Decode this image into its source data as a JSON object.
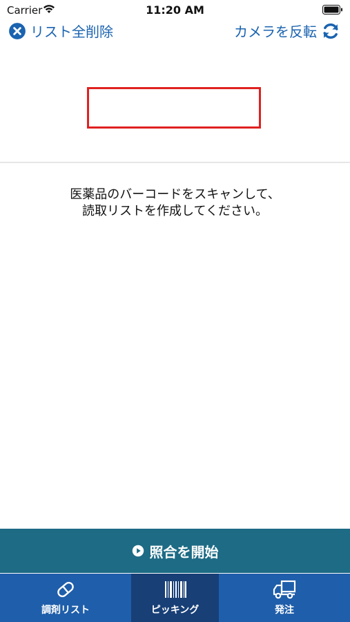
{
  "status_bar": {
    "carrier": "Carrier",
    "time": "11:20 AM"
  },
  "nav": {
    "clear_list_label": "リスト全削除",
    "flip_camera_label": "カメラを反転"
  },
  "instructions": {
    "line1": "医薬品のバーコードをスキャンして、",
    "line2": "読取リストを作成してください。"
  },
  "start_button": {
    "label": "照合を開始"
  },
  "tabs": [
    {
      "label": "調剤リスト",
      "icon": "pill-icon"
    },
    {
      "label": "ピッキング",
      "icon": "barcode-icon"
    },
    {
      "label": "発注",
      "icon": "truck-icon"
    }
  ],
  "colors": {
    "accent_blue": "#1a63b0",
    "start_bar": "#1d6b85",
    "tab_bar": "#1f5eaa",
    "tab_active": "#183f76",
    "scan_frame": "#e02020"
  }
}
